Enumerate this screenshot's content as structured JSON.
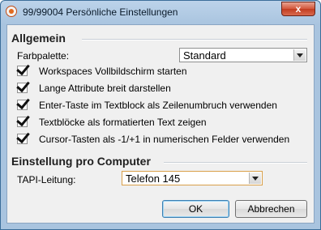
{
  "window": {
    "title": "99/99004 Persönliche Einstellungen",
    "close_label": "x"
  },
  "general": {
    "heading": "Allgemein",
    "palette_label": "Farbpalette:",
    "palette_value": "Standard",
    "options": [
      {
        "label": "Workspaces Vollbildschirm starten",
        "checked": true
      },
      {
        "label": "Lange Attribute breit darstellen",
        "checked": true
      },
      {
        "label": "Enter-Taste im Textblock als Zeilenumbruch verwenden",
        "checked": true
      },
      {
        "label": "Textblöcke als formatierten Text zeigen",
        "checked": true
      },
      {
        "label": "Cursor-Tasten als -1/+1 in numerischen Felder verwenden",
        "checked": true
      }
    ]
  },
  "computer": {
    "heading": "Einstellung pro Computer",
    "tapi_label": "TAPI-Leitung:",
    "tapi_value": "Telefon 145"
  },
  "buttons": {
    "ok": "OK",
    "cancel": "Abbrechen"
  }
}
